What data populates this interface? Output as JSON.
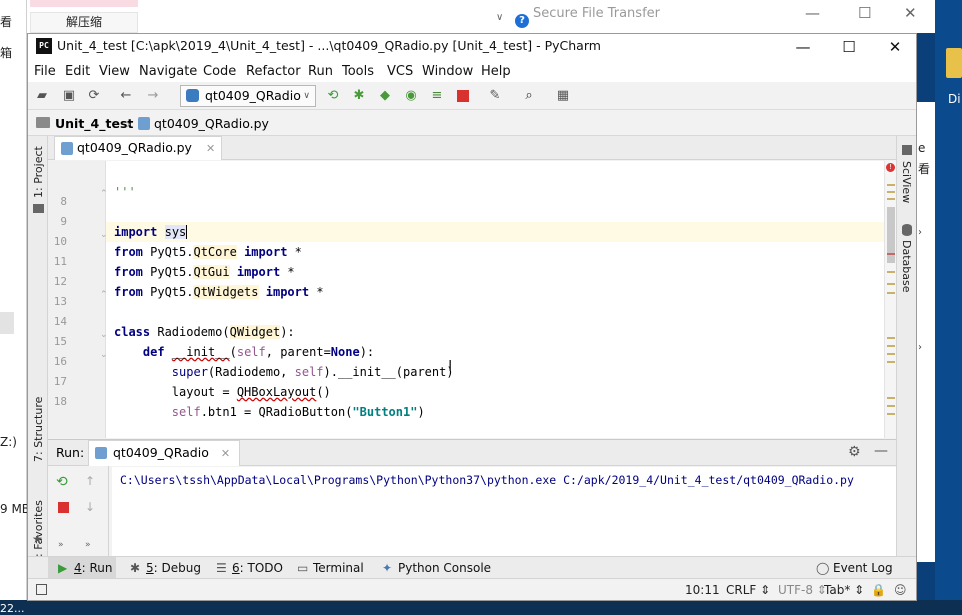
{
  "background": {
    "left_chars": [
      "看",
      "箱",
      "Z:)",
      "9 MB",
      "22..."
    ],
    "top_tab": "解压缩",
    "sft_title": "Secure File Transfer",
    "right_labels": [
      "Di",
      "看"
    ],
    "right_strip_chars": [
      "e",
      "看"
    ]
  },
  "window": {
    "title": "Unit_4_test [C:\\apk\\2019_4\\Unit_4_test] - ...\\qt0409_QRadio.py [Unit_4_test] - PyCharm",
    "app_icon": "PC",
    "controls": {
      "minimize": "—",
      "maximize": "☐",
      "close": "✕"
    }
  },
  "menu": [
    "File",
    "Edit",
    "View",
    "Navigate",
    "Code",
    "Refactor",
    "Run",
    "Tools",
    "VCS",
    "Window",
    "Help"
  ],
  "toolbar": {
    "run_config": "qt0409_QRadio"
  },
  "breadcrumb": {
    "project": "Unit_4_test",
    "file": "qt0409_QRadio.py"
  },
  "left_tool_windows": [
    "1: Project",
    "7: Structure",
    "2: Favorites"
  ],
  "right_tool_windows": [
    "SciView",
    "Database"
  ],
  "editor": {
    "tab": "qt0409_QRadio.py",
    "lines": [
      {
        "n": "8",
        "text": "'''"
      },
      {
        "n": "9",
        "text": ""
      },
      {
        "n": "10",
        "text": "import sys"
      },
      {
        "n": "11",
        "text": "from PyQt5.QtCore import *"
      },
      {
        "n": "12",
        "text": "from PyQt5.QtGui import *"
      },
      {
        "n": "13",
        "text": "from PyQt5.QtWidgets import *"
      },
      {
        "n": "14",
        "text": ""
      },
      {
        "n": "15",
        "text": "class Radiodemo(QWidget):"
      },
      {
        "n": "16",
        "text": "    def __init__(self, parent=None):"
      },
      {
        "n": "17",
        "text": "        super(Radiodemo, self).__init__(parent)"
      },
      {
        "n": "18",
        "text": "        layout = QHBoxLayout()"
      },
      {
        "n": "",
        "text": "        self.btn1 = QRadioButton(\"Button1\")"
      }
    ]
  },
  "run": {
    "label": "Run:",
    "tab": "qt0409_QRadio",
    "output": "C:\\Users\\tssh\\AppData\\Local\\Programs\\Python\\Python37\\python.exe C:/apk/2019_4/Unit_4_test/qt0409_QRadio.py"
  },
  "bottom_tabs": [
    {
      "key": "4",
      "label": ": Run"
    },
    {
      "key": "5",
      "label": ": Debug"
    },
    {
      "key": "6",
      "label": ": TODO"
    },
    {
      "key": "",
      "label": "Terminal"
    },
    {
      "key": "",
      "label": "Python Console"
    }
  ],
  "event_log": "Event Log",
  "status": {
    "position": "10:11",
    "line_sep": "CRLF",
    "encoding": "UTF-8",
    "indent": "Tab*"
  },
  "colors": {
    "keyword": "#000080",
    "self": "#94558d",
    "string": "#008080",
    "current_line": "#fffae3"
  }
}
